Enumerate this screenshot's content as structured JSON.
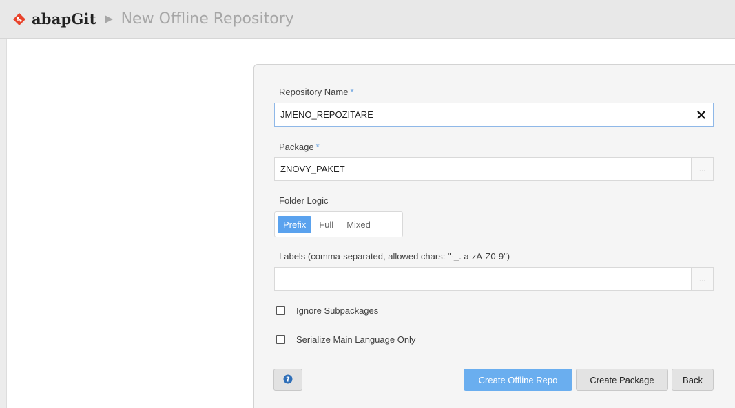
{
  "header": {
    "brand": "abapGit",
    "title": "New Offline Repository"
  },
  "form": {
    "repo_name": {
      "label": "Repository Name",
      "required_mark": "*",
      "value": "JMENO_REPOZITARE"
    },
    "package": {
      "label": "Package",
      "required_mark": "*",
      "value": "ZNOVY_PAKET",
      "browse": "..."
    },
    "folder_logic": {
      "label": "Folder Logic",
      "options": [
        "Prefix",
        "Full",
        "Mixed"
      ],
      "selected": "Prefix"
    },
    "labels": {
      "label": "Labels (comma-separated, allowed chars: \"-_. a-zA-Z0-9\")",
      "value": "",
      "browse": "..."
    },
    "ignore_subpackages": {
      "label": "Ignore Subpackages",
      "checked": false
    },
    "serialize_main_lang": {
      "label": "Serialize Main Language Only",
      "checked": false
    }
  },
  "buttons": {
    "create_offline": "Create Offline Repo",
    "create_package": "Create Package",
    "back": "Back"
  },
  "icons": {
    "logo": "abapgit-diamond-icon",
    "breadcrumb": "triangle-right-icon",
    "clear": "close-icon",
    "help": "question-circle-icon"
  },
  "colors": {
    "logo": "#e8432b",
    "accent": "#5aa2ee",
    "required": "#6aa3e0",
    "help_icon": "#2f6fb8"
  }
}
